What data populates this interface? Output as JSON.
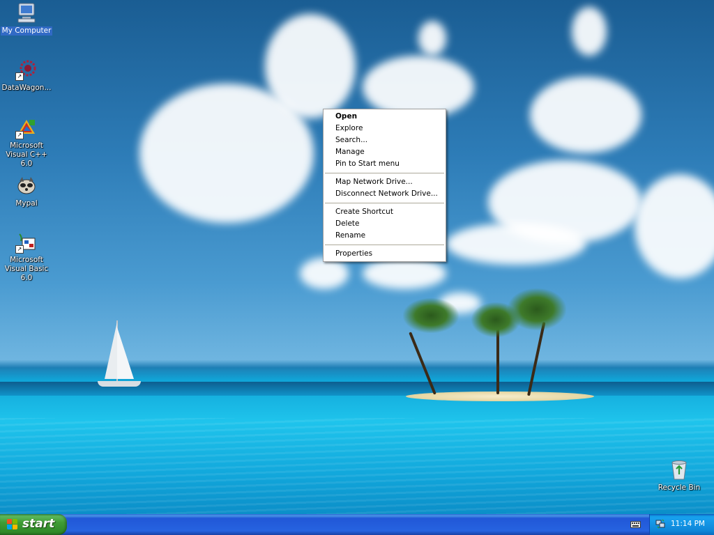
{
  "desktop": {
    "icons": [
      {
        "label": "My Computer",
        "icon": "my-computer-icon"
      },
      {
        "label": "DataWagon...",
        "icon": "datawagon-icon"
      },
      {
        "label": "Microsoft Visual C++ 6.0",
        "icon": "visual-cpp-icon"
      },
      {
        "label": "Mypal",
        "icon": "mypal-icon"
      },
      {
        "label": "Microsoft Visual Basic 6.0",
        "icon": "visual-basic-icon"
      },
      {
        "label": "Recycle Bin",
        "icon": "recycle-bin-icon"
      }
    ]
  },
  "context_menu": {
    "items": [
      {
        "label": "Open",
        "bold": true
      },
      {
        "label": "Explore"
      },
      {
        "label": "Search..."
      },
      {
        "label": "Manage"
      },
      {
        "label": "Pin to Start menu"
      },
      {
        "label": "Map Network Drive..."
      },
      {
        "label": "Disconnect Network Drive..."
      },
      {
        "label": "Create Shortcut"
      },
      {
        "label": "Delete"
      },
      {
        "label": "Rename"
      },
      {
        "label": "Properties"
      }
    ]
  },
  "taskbar": {
    "start_label": "start",
    "clock": "11:14 PM",
    "keyboard_icon": "keyboard-icon",
    "tray_icon": "network-tray-icon"
  },
  "colors": {
    "taskbar_blue": "#2663e0",
    "start_green": "#3f9c35",
    "selection_blue": "#316ac5"
  }
}
